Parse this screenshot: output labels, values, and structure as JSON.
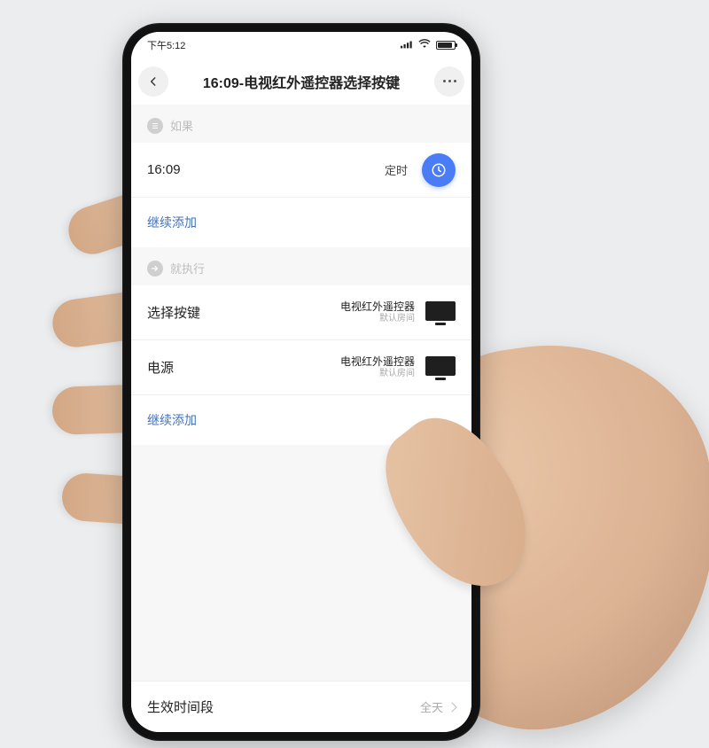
{
  "statusbar": {
    "time": "下午5:12"
  },
  "header": {
    "title": "16:09-电视红外遥控器选择按键"
  },
  "sections": {
    "if_label": "如果",
    "then_label": "就执行"
  },
  "if_rows": {
    "time_value": "16:09",
    "time_tag": "定时"
  },
  "actions": {
    "continue_add": "继续添加"
  },
  "then_rows": [
    {
      "title": "选择按键",
      "device": "电视红外遥控器",
      "room": "默认房间"
    },
    {
      "title": "电源",
      "device": "电视红外遥控器",
      "room": "默认房间"
    }
  ],
  "footer": {
    "label": "生效时间段",
    "value": "全天"
  }
}
